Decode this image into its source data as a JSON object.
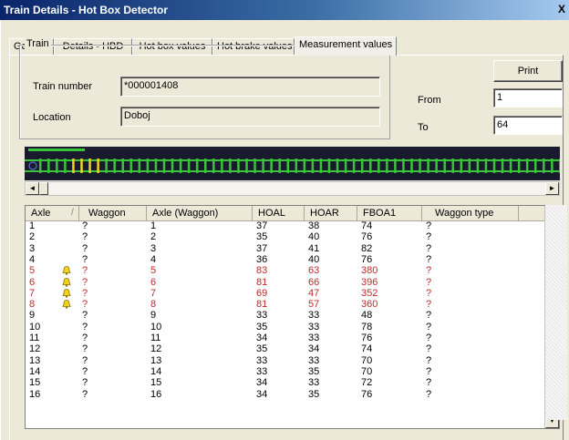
{
  "window": {
    "title": "Train Details - Hot Box Detector",
    "close_glyph": "X"
  },
  "tabs": [
    {
      "label": "General",
      "active": false
    },
    {
      "label": "Details - HBD",
      "active": false
    },
    {
      "label": "Hot box values",
      "active": false
    },
    {
      "label": "Hot brake values",
      "active": false
    },
    {
      "label": "Measurement values",
      "active": true
    }
  ],
  "train": {
    "group_label": "Train",
    "number_label": "Train number",
    "number_value": "*000001408",
    "location_label": "Location",
    "location_value": "Doboj"
  },
  "controls": {
    "print_label": "Print",
    "from_label": "From",
    "from_value": "1",
    "to_label": "To",
    "to_value": "64"
  },
  "strip": {
    "axle_count": 64,
    "alarm_axles": [
      5,
      6,
      7,
      8
    ],
    "colors": {
      "background": "#1a1a2e",
      "rail": "#39c339",
      "axle_normal": "#39c339",
      "axle_alarm": "#f2d41f",
      "progress": "#39c339"
    }
  },
  "scroll_glyphs": {
    "left": "◄",
    "right": "►",
    "up": "▲",
    "down": "▼"
  },
  "table": {
    "sort_indicator": "/",
    "columns": [
      "Axle",
      "Waggon",
      "Axle (Waggon)",
      "HOAL",
      "HOAR",
      "FBOA1",
      "Waggon type"
    ],
    "alarm_color": "#c0292c",
    "rows": [
      {
        "axle": "1",
        "waggon": "?",
        "axle_waggon": "1",
        "hoal": "37",
        "hoar": "38",
        "fboa1": "74",
        "type": "?",
        "alarm": false
      },
      {
        "axle": "2",
        "waggon": "?",
        "axle_waggon": "2",
        "hoal": "35",
        "hoar": "40",
        "fboa1": "76",
        "type": "?",
        "alarm": false
      },
      {
        "axle": "3",
        "waggon": "?",
        "axle_waggon": "3",
        "hoal": "37",
        "hoar": "41",
        "fboa1": "82",
        "type": "?",
        "alarm": false
      },
      {
        "axle": "4",
        "waggon": "?",
        "axle_waggon": "4",
        "hoal": "36",
        "hoar": "40",
        "fboa1": "76",
        "type": "?",
        "alarm": false
      },
      {
        "axle": "5",
        "waggon": "?",
        "axle_waggon": "5",
        "hoal": "83",
        "hoar": "63",
        "fboa1": "380",
        "type": "?",
        "alarm": true
      },
      {
        "axle": "6",
        "waggon": "?",
        "axle_waggon": "6",
        "hoal": "81",
        "hoar": "66",
        "fboa1": "396",
        "type": "?",
        "alarm": true
      },
      {
        "axle": "7",
        "waggon": "?",
        "axle_waggon": "7",
        "hoal": "69",
        "hoar": "47",
        "fboa1": "352",
        "type": "?",
        "alarm": true
      },
      {
        "axle": "8",
        "waggon": "?",
        "axle_waggon": "8",
        "hoal": "81",
        "hoar": "57",
        "fboa1": "360",
        "type": "?",
        "alarm": true
      },
      {
        "axle": "9",
        "waggon": "?",
        "axle_waggon": "9",
        "hoal": "33",
        "hoar": "33",
        "fboa1": "48",
        "type": "?",
        "alarm": false
      },
      {
        "axle": "10",
        "waggon": "?",
        "axle_waggon": "10",
        "hoal": "35",
        "hoar": "33",
        "fboa1": "78",
        "type": "?",
        "alarm": false
      },
      {
        "axle": "11",
        "waggon": "?",
        "axle_waggon": "11",
        "hoal": "34",
        "hoar": "33",
        "fboa1": "76",
        "type": "?",
        "alarm": false
      },
      {
        "axle": "12",
        "waggon": "?",
        "axle_waggon": "12",
        "hoal": "35",
        "hoar": "34",
        "fboa1": "74",
        "type": "?",
        "alarm": false
      },
      {
        "axle": "13",
        "waggon": "?",
        "axle_waggon": "13",
        "hoal": "33",
        "hoar": "33",
        "fboa1": "70",
        "type": "?",
        "alarm": false
      },
      {
        "axle": "14",
        "waggon": "?",
        "axle_waggon": "14",
        "hoal": "33",
        "hoar": "35",
        "fboa1": "70",
        "type": "?",
        "alarm": false
      },
      {
        "axle": "15",
        "waggon": "?",
        "axle_waggon": "15",
        "hoal": "34",
        "hoar": "33",
        "fboa1": "72",
        "type": "?",
        "alarm": false
      },
      {
        "axle": "16",
        "waggon": "?",
        "axle_waggon": "16",
        "hoal": "34",
        "hoar": "35",
        "fboa1": "76",
        "type": "?",
        "alarm": false
      }
    ]
  }
}
